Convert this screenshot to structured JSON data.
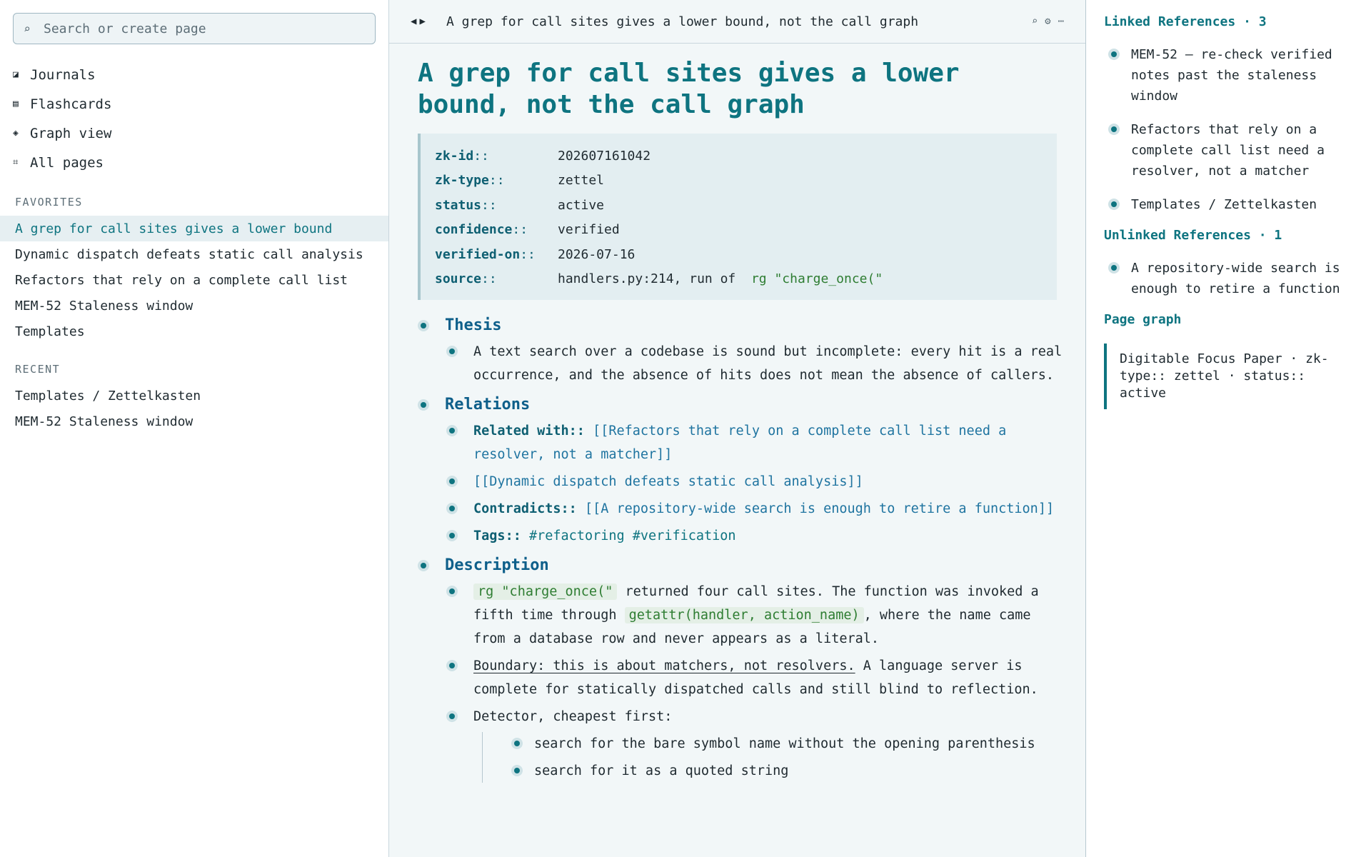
{
  "sidebar": {
    "search_placeholder": "Search or create page",
    "nav": [
      {
        "icon": "journal-icon",
        "glyph": "◪",
        "label": "Journals"
      },
      {
        "icon": "flashcards-icon",
        "glyph": "▤",
        "label": "Flashcards"
      },
      {
        "icon": "graph-view-icon",
        "glyph": "◈",
        "label": "Graph view"
      },
      {
        "icon": "all-pages-icon",
        "glyph": "⌗",
        "label": "All pages"
      }
    ],
    "favorites_label": "FAVORITES",
    "favorites": [
      "A grep for call sites gives a lower bound",
      "Dynamic dispatch defeats static call analysis",
      "Refactors that rely on a complete call list",
      "MEM-52 Staleness window",
      "Templates"
    ],
    "recent_label": "RECENT",
    "recent": [
      "Templates / Zettelkasten",
      "MEM-52 Staleness window"
    ]
  },
  "topbar": {
    "back": "◀",
    "forward": "▶",
    "title": "A grep for call sites gives a lower bound, not the call graph",
    "search_glyph": "⌕",
    "settings_glyph": "⚙",
    "more_glyph": "⋯"
  },
  "page": {
    "title": "A grep for call sites gives a lower bound, not the call graph",
    "properties": [
      {
        "key": "zk-id",
        "value": "202607161042"
      },
      {
        "key": "zk-type",
        "value": "zettel"
      },
      {
        "key": "status",
        "value": "active"
      },
      {
        "key": "confidence",
        "value": "verified"
      },
      {
        "key": "verified-on",
        "value": "2026-07-16"
      },
      {
        "key": "source",
        "value": "handlers.py:214, run of",
        "code": "rg \"charge_once(\""
      }
    ],
    "sep": "::",
    "thesis": {
      "heading": "Thesis",
      "text": "A text search over a codebase is sound but incomplete: every hit is a real occurrence, and the absence of hits does not mean the absence of callers."
    },
    "relations": {
      "heading": "Relations",
      "related_key": "Related with",
      "related_link": "[[Refactors that rely on a complete call list need a resolver, not a matcher]]",
      "link2": "[[Dynamic dispatch defeats static call analysis]]",
      "contradicts_key": "Contradicts",
      "contradicts_link": "[[A repository-wide search is enough to retire a function]]",
      "tags_key": "Tags",
      "tags": "#refactoring #verification"
    },
    "description": {
      "heading": "Description",
      "code1": "rg \"charge_once(\"",
      "t1": " returned four call sites. The function was invoked a fifth time through ",
      "code2": "getattr(handler, action_name)",
      "t2": ", where the name came from a database row and never appears as a literal.",
      "boundary": "Boundary: this is about matchers, not resolvers.",
      "boundary_rest": " A language server is complete for statically dispatched calls and still blind to reflection.",
      "detector": "Detector, cheapest first:",
      "sub": [
        "search for the bare symbol name without the opening parenthesis",
        "search for it as a quoted string"
      ]
    }
  },
  "right": {
    "linked_heading": "Linked References · 3",
    "linked": [
      "MEM-52 — re-check verified notes past the staleness window",
      "Refactors that rely on a complete call list need a resolver, not a matcher",
      "Templates / Zettelkasten"
    ],
    "unlinked_heading": "Unlinked References · 1",
    "unlinked": [
      "A repository-wide search is enough to retire a function"
    ],
    "graph_heading": "Page graph",
    "graph_text": "Digitable Focus Paper · zk-type:: zettel · status:: active"
  },
  "colors": {
    "accent": "#0e7480",
    "heading": "#0e5f8a",
    "link": "#1f74a0",
    "code": "#2e7d32"
  }
}
